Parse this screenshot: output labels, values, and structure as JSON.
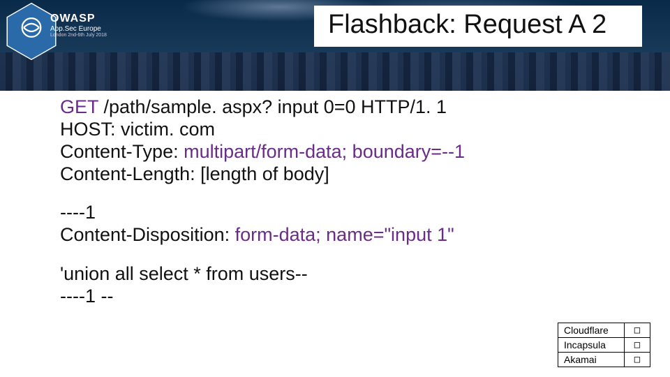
{
  "header": {
    "title": "Flashback: Request A 2",
    "logo": {
      "name": "OWASP",
      "sub1": "App.Sec Europe",
      "sub2": "London 2nd-6th July 2018"
    }
  },
  "content": {
    "l1a": "GET",
    "l1b": " /path/sample. aspx? input 0=0 HTTP/1. 1",
    "l2": "HOST: victim. com",
    "l3a": "Content-Type: ",
    "l3b": "multipart/form-data; boundary=--1",
    "l4": "Content-Length: [length of body]",
    "l5": "----1",
    "l6a": "Content-Disposition: ",
    "l6b": "form-data; name=\"input 1\"",
    "l7": "'union all select * from users--",
    "l8": "----1 --"
  },
  "vendors": {
    "r1": "Cloudflare",
    "r2": "Incapsula",
    "r3": "Akamai",
    "box": "□"
  }
}
